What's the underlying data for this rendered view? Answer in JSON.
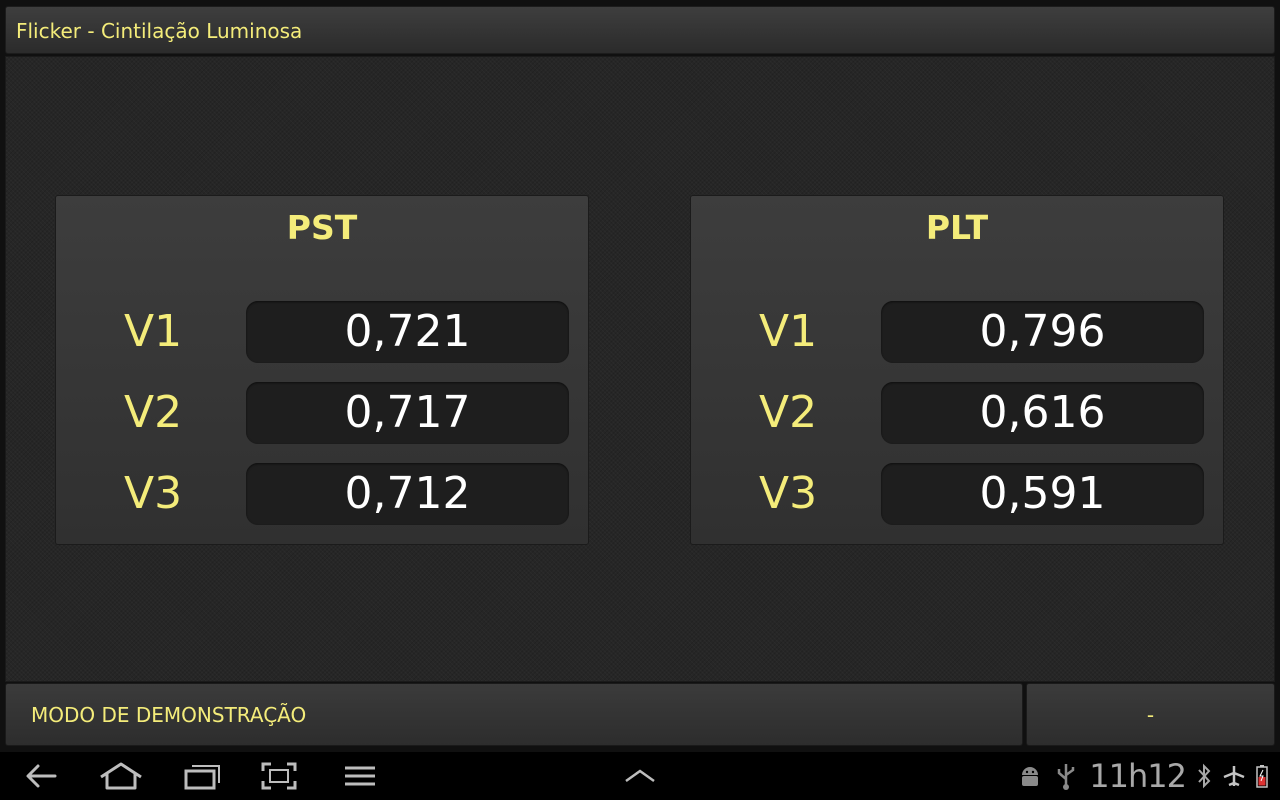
{
  "window": {
    "title": "Flicker - Cintilação Luminosa"
  },
  "panels": [
    {
      "title": "PST",
      "rows": [
        {
          "label": "V1",
          "value": "0,721"
        },
        {
          "label": "V2",
          "value": "0,717"
        },
        {
          "label": "V3",
          "value": "0,712"
        }
      ]
    },
    {
      "title": "PLT",
      "rows": [
        {
          "label": "V1",
          "value": "0,796"
        },
        {
          "label": "V2",
          "value": "0,616"
        },
        {
          "label": "V3",
          "value": "0,591"
        }
      ]
    }
  ],
  "status": {
    "mode": "MODO DE DEMONSTRAÇÃO",
    "right": "-"
  },
  "systembar": {
    "clock": "11h12",
    "icons": [
      "back-icon",
      "home-icon",
      "recent-apps-icon",
      "screenshot-icon",
      "menu-icon",
      "chevron-up-icon",
      "android-debug-icon",
      "usb-icon",
      "bluetooth-icon",
      "airplane-mode-icon",
      "battery-icon"
    ]
  },
  "colors": {
    "accent_yellow": "#f4ec7a",
    "value_text": "#ffffff",
    "value_box": "#1e1e1e"
  }
}
